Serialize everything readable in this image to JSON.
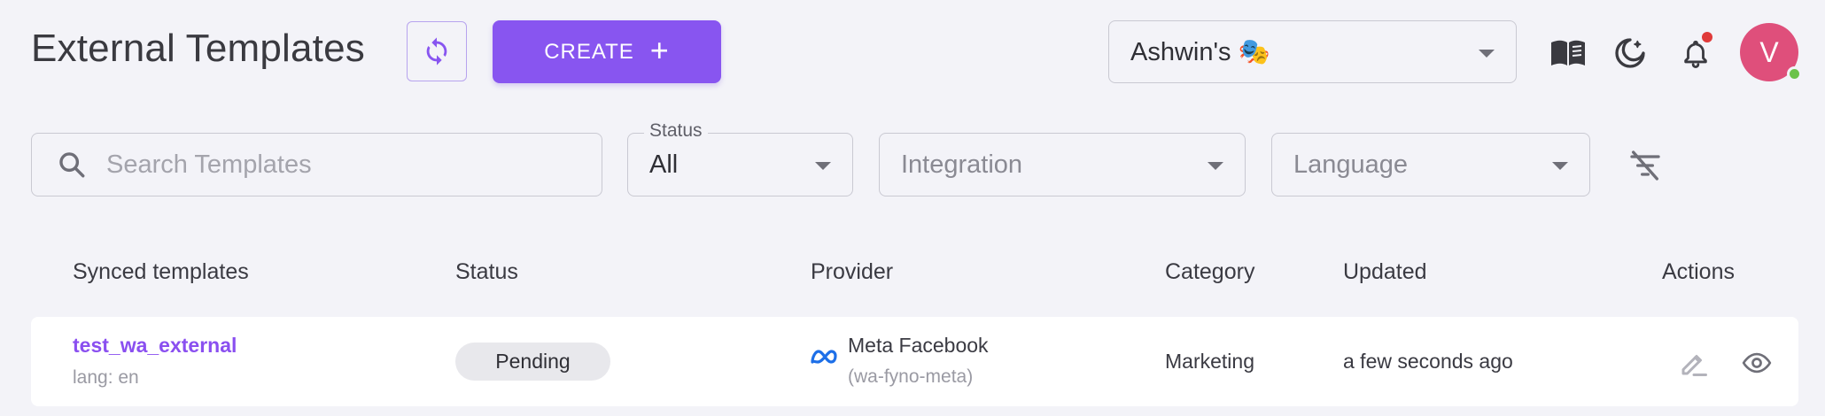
{
  "header": {
    "title": "External Templates",
    "refresh_icon": "refresh-icon",
    "create_label": "CREATE",
    "create_icon": "plus-icon",
    "workspace": "Ashwin's 🎭",
    "icons": [
      "book-icon",
      "dark-mode-icon",
      "bell-icon"
    ],
    "avatar_initial": "V",
    "avatar_color": "#df4f7b"
  },
  "filters": {
    "search_placeholder": "Search Templates",
    "status_label": "Status",
    "status_value": "All",
    "integration_placeholder": "Integration",
    "language_placeholder": "Language",
    "clear_icon": "filter-off-icon"
  },
  "table": {
    "columns": [
      "Synced templates",
      "Status",
      "Provider",
      "Category",
      "Updated",
      "Actions"
    ],
    "rows": [
      {
        "name": "test_wa_external",
        "lang": "lang: en",
        "status": "Pending",
        "provider_icon": "meta-icon",
        "provider": "Meta Facebook",
        "provider_id": "(wa-fyno-meta)",
        "category": "Marketing",
        "updated": "a few seconds ago",
        "actions": [
          "edit-icon",
          "view-icon"
        ]
      }
    ]
  },
  "colors": {
    "accent": "#8855f0",
    "background": "#f3f3f8",
    "notification": "#e03a3a",
    "online": "#6bc24a"
  }
}
